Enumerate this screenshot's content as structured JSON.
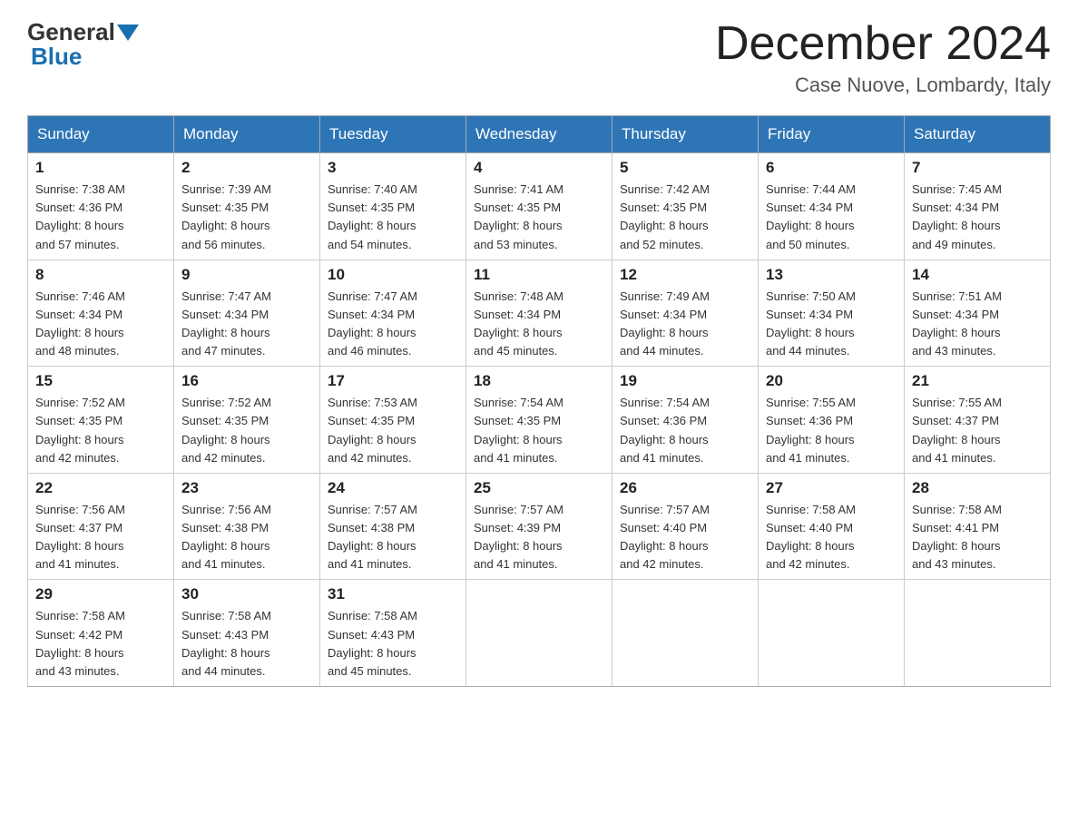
{
  "header": {
    "logo_text1": "General",
    "logo_text2": "Blue",
    "month_title": "December 2024",
    "location": "Case Nuove, Lombardy, Italy"
  },
  "days_of_week": [
    "Sunday",
    "Monday",
    "Tuesday",
    "Wednesday",
    "Thursday",
    "Friday",
    "Saturday"
  ],
  "weeks": [
    [
      {
        "day": "1",
        "sunrise": "7:38 AM",
        "sunset": "4:36 PM",
        "daylight": "8 hours and 57 minutes."
      },
      {
        "day": "2",
        "sunrise": "7:39 AM",
        "sunset": "4:35 PM",
        "daylight": "8 hours and 56 minutes."
      },
      {
        "day": "3",
        "sunrise": "7:40 AM",
        "sunset": "4:35 PM",
        "daylight": "8 hours and 54 minutes."
      },
      {
        "day": "4",
        "sunrise": "7:41 AM",
        "sunset": "4:35 PM",
        "daylight": "8 hours and 53 minutes."
      },
      {
        "day": "5",
        "sunrise": "7:42 AM",
        "sunset": "4:35 PM",
        "daylight": "8 hours and 52 minutes."
      },
      {
        "day": "6",
        "sunrise": "7:44 AM",
        "sunset": "4:34 PM",
        "daylight": "8 hours and 50 minutes."
      },
      {
        "day": "7",
        "sunrise": "7:45 AM",
        "sunset": "4:34 PM",
        "daylight": "8 hours and 49 minutes."
      }
    ],
    [
      {
        "day": "8",
        "sunrise": "7:46 AM",
        "sunset": "4:34 PM",
        "daylight": "8 hours and 48 minutes."
      },
      {
        "day": "9",
        "sunrise": "7:47 AM",
        "sunset": "4:34 PM",
        "daylight": "8 hours and 47 minutes."
      },
      {
        "day": "10",
        "sunrise": "7:47 AM",
        "sunset": "4:34 PM",
        "daylight": "8 hours and 46 minutes."
      },
      {
        "day": "11",
        "sunrise": "7:48 AM",
        "sunset": "4:34 PM",
        "daylight": "8 hours and 45 minutes."
      },
      {
        "day": "12",
        "sunrise": "7:49 AM",
        "sunset": "4:34 PM",
        "daylight": "8 hours and 44 minutes."
      },
      {
        "day": "13",
        "sunrise": "7:50 AM",
        "sunset": "4:34 PM",
        "daylight": "8 hours and 44 minutes."
      },
      {
        "day": "14",
        "sunrise": "7:51 AM",
        "sunset": "4:34 PM",
        "daylight": "8 hours and 43 minutes."
      }
    ],
    [
      {
        "day": "15",
        "sunrise": "7:52 AM",
        "sunset": "4:35 PM",
        "daylight": "8 hours and 42 minutes."
      },
      {
        "day": "16",
        "sunrise": "7:52 AM",
        "sunset": "4:35 PM",
        "daylight": "8 hours and 42 minutes."
      },
      {
        "day": "17",
        "sunrise": "7:53 AM",
        "sunset": "4:35 PM",
        "daylight": "8 hours and 42 minutes."
      },
      {
        "day": "18",
        "sunrise": "7:54 AM",
        "sunset": "4:35 PM",
        "daylight": "8 hours and 41 minutes."
      },
      {
        "day": "19",
        "sunrise": "7:54 AM",
        "sunset": "4:36 PM",
        "daylight": "8 hours and 41 minutes."
      },
      {
        "day": "20",
        "sunrise": "7:55 AM",
        "sunset": "4:36 PM",
        "daylight": "8 hours and 41 minutes."
      },
      {
        "day": "21",
        "sunrise": "7:55 AM",
        "sunset": "4:37 PM",
        "daylight": "8 hours and 41 minutes."
      }
    ],
    [
      {
        "day": "22",
        "sunrise": "7:56 AM",
        "sunset": "4:37 PM",
        "daylight": "8 hours and 41 minutes."
      },
      {
        "day": "23",
        "sunrise": "7:56 AM",
        "sunset": "4:38 PM",
        "daylight": "8 hours and 41 minutes."
      },
      {
        "day": "24",
        "sunrise": "7:57 AM",
        "sunset": "4:38 PM",
        "daylight": "8 hours and 41 minutes."
      },
      {
        "day": "25",
        "sunrise": "7:57 AM",
        "sunset": "4:39 PM",
        "daylight": "8 hours and 41 minutes."
      },
      {
        "day": "26",
        "sunrise": "7:57 AM",
        "sunset": "4:40 PM",
        "daylight": "8 hours and 42 minutes."
      },
      {
        "day": "27",
        "sunrise": "7:58 AM",
        "sunset": "4:40 PM",
        "daylight": "8 hours and 42 minutes."
      },
      {
        "day": "28",
        "sunrise": "7:58 AM",
        "sunset": "4:41 PM",
        "daylight": "8 hours and 43 minutes."
      }
    ],
    [
      {
        "day": "29",
        "sunrise": "7:58 AM",
        "sunset": "4:42 PM",
        "daylight": "8 hours and 43 minutes."
      },
      {
        "day": "30",
        "sunrise": "7:58 AM",
        "sunset": "4:43 PM",
        "daylight": "8 hours and 44 minutes."
      },
      {
        "day": "31",
        "sunrise": "7:58 AM",
        "sunset": "4:43 PM",
        "daylight": "8 hours and 45 minutes."
      },
      null,
      null,
      null,
      null
    ]
  ],
  "labels": {
    "sunrise": "Sunrise:",
    "sunset": "Sunset:",
    "daylight": "Daylight:"
  }
}
